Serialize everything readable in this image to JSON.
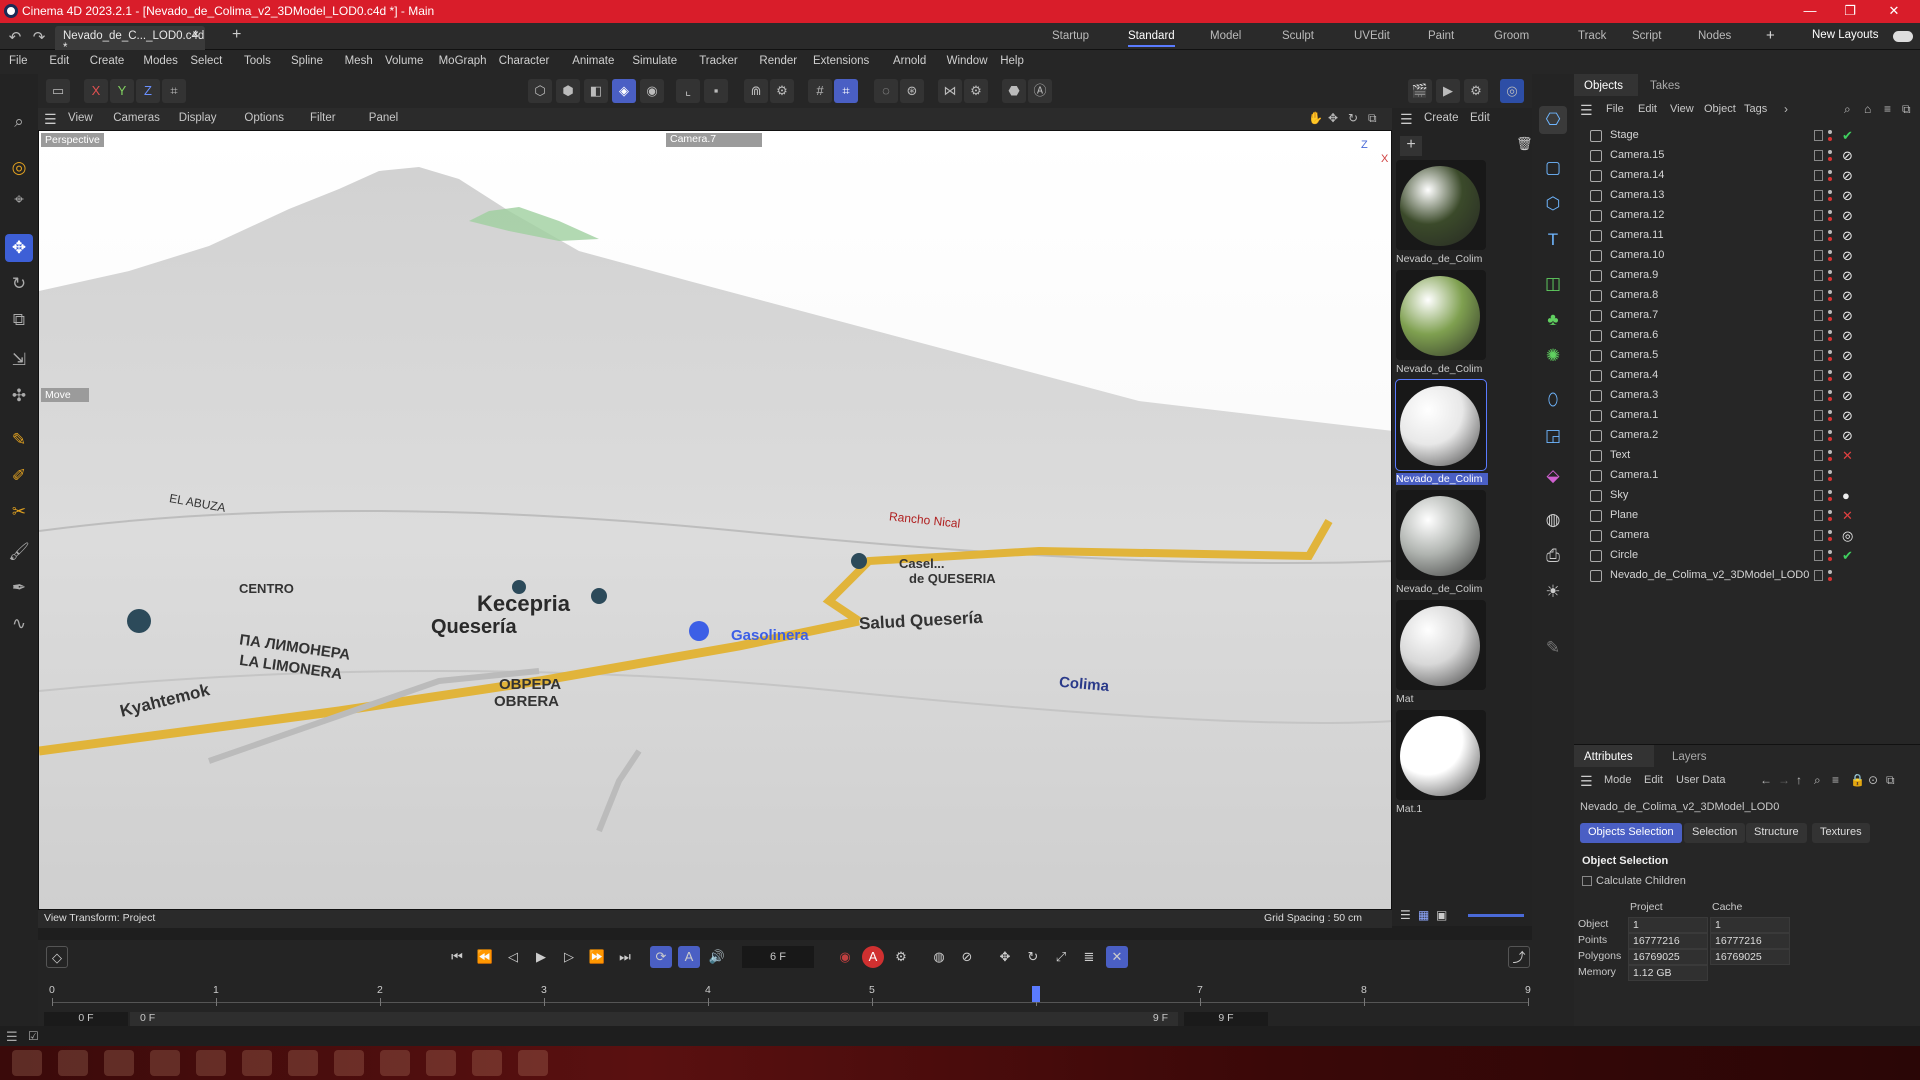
{
  "window": {
    "title": "Cinema 4D 2023.2.1 - [Nevado_de_Colima_v2_3DModel_LOD0.c4d *] - Main"
  },
  "tabs": {
    "doc": "Nevado_de_C..._LOD0.c4d *",
    "close": "×",
    "new": "+"
  },
  "layouts": [
    "Startup",
    "Standard",
    "Model",
    "Sculpt",
    "UVEdit",
    "Paint",
    "Groom",
    "Track",
    "Script",
    "Nodes"
  ],
  "new_layouts": "New Layouts",
  "menu": [
    "File",
    "Edit",
    "Create",
    "Modes",
    "Select",
    "Tools",
    "Spline",
    "Mesh",
    "Volume",
    "MoGraph",
    "Character",
    "Animate",
    "Simulate",
    "Tracker",
    "Render",
    "Extensions",
    "Arnold",
    "Window",
    "Help"
  ],
  "axes": {
    "x": "X",
    "y": "Y",
    "z": "Z"
  },
  "viewport": {
    "menu": [
      "View",
      "Cameras",
      "Display",
      "Options",
      "Filter",
      "Panel"
    ],
    "label": "Perspective",
    "camera": "Camera.7",
    "move_hud": "Move",
    "status_left": "View Transform: Project",
    "status_right": "Grid Spacing : 50 cm",
    "map_labels": [
      "Kecepria",
      "Quesería",
      "ПА ЛИМОНЕРА",
      "LA LIMONERA",
      "ОВРЕРА",
      "OBRERA",
      "Salud Quesería",
      "Gasolinera",
      "Casel...",
      "de QUESERIA",
      "Rancho Nical",
      "CENTRO",
      "EL ABUZA",
      "Kyahtemok",
      "Colima"
    ],
    "axis_z": "Z",
    "axis_x": "X"
  },
  "materials": {
    "menu": [
      "Create",
      "Edit"
    ],
    "items": [
      {
        "label": "Nevado_de_Colim",
        "color": "#3b4a2a"
      },
      {
        "label": "Nevado_de_Colim",
        "color": "#7fa050"
      },
      {
        "label": "Nevado_de_Colim",
        "color": "#e8e8e8"
      },
      {
        "label": "Nevado_de_Colim",
        "color": "#b0b4b0"
      },
      {
        "label": "Mat",
        "color": "#d8d8d8"
      },
      {
        "label": "Mat.1",
        "color": "#ffffff"
      }
    ]
  },
  "objects": {
    "tabs": [
      "Objects",
      "Takes"
    ],
    "menu": [
      "File",
      "Edit",
      "View",
      "Object",
      "Tags"
    ],
    "items": [
      {
        "name": "Stage",
        "tag": "✔",
        "tag_class": "check"
      },
      {
        "name": "Camera.15",
        "tag": "⊘",
        "tag_class": ""
      },
      {
        "name": "Camera.14",
        "tag": "⊘",
        "tag_class": ""
      },
      {
        "name": "Camera.13",
        "tag": "⊘",
        "tag_class": ""
      },
      {
        "name": "Camera.12",
        "tag": "⊘",
        "tag_class": ""
      },
      {
        "name": "Camera.11",
        "tag": "⊘",
        "tag_class": ""
      },
      {
        "name": "Camera.10",
        "tag": "⊘",
        "tag_class": ""
      },
      {
        "name": "Camera.9",
        "tag": "⊘",
        "tag_class": ""
      },
      {
        "name": "Camera.8",
        "tag": "⊘",
        "tag_class": ""
      },
      {
        "name": "Camera.7",
        "tag": "⊘",
        "tag_class": ""
      },
      {
        "name": "Camera.6",
        "tag": "⊘",
        "tag_class": ""
      },
      {
        "name": "Camera.5",
        "tag": "⊘",
        "tag_class": ""
      },
      {
        "name": "Camera.4",
        "tag": "⊘",
        "tag_class": ""
      },
      {
        "name": "Camera.3",
        "tag": "⊘",
        "tag_class": ""
      },
      {
        "name": "Camera.1",
        "tag": "⊘",
        "tag_class": ""
      },
      {
        "name": "Camera.2",
        "tag": "⊘",
        "tag_class": ""
      },
      {
        "name": "Text",
        "tag": "✕",
        "tag_class": "cross"
      },
      {
        "name": "Camera.1",
        "tag": "",
        "tag_class": ""
      },
      {
        "name": "Sky",
        "tag": "●",
        "tag_class": ""
      },
      {
        "name": "Plane",
        "tag": "✕",
        "tag_class": "cross"
      },
      {
        "name": "Camera",
        "tag": "◎",
        "tag_class": ""
      },
      {
        "name": "Circle",
        "tag": "✔",
        "tag_class": "check"
      },
      {
        "name": "Nevado_de_Colima_v2_3DModel_LOD0",
        "tag": "",
        "tag_class": ""
      }
    ]
  },
  "attributes": {
    "tabs": [
      "Attributes",
      "Layers"
    ],
    "menu": [
      "Mode",
      "Edit",
      "User Data"
    ],
    "object_name": "Nevado_de_Colima_v2_3DModel_LOD0",
    "subtabs": [
      "Objects Selection",
      "Selection",
      "Structure",
      "Textures"
    ],
    "section": "Object Selection",
    "calc_children": "Calculate Children",
    "col_project": "Project",
    "col_cache": "Cache",
    "rows": [
      {
        "label": "Object",
        "project": "1",
        "cache": "1"
      },
      {
        "label": "Points",
        "project": "16777216",
        "cache": "16777216"
      },
      {
        "label": "Polygons",
        "project": "16769025",
        "cache": "16769025"
      },
      {
        "label": "Memory",
        "project": "1.12 GB",
        "cache": ""
      }
    ]
  },
  "timeline": {
    "current_frame": "6 F",
    "ticks": [
      "0",
      "1",
      "2",
      "3",
      "4",
      "5",
      "6",
      "7",
      "8",
      "9"
    ],
    "start": "0 F",
    "range_start": "0 F",
    "range_end": "9 F",
    "end": "9 F",
    "playhead_frame": 6
  }
}
